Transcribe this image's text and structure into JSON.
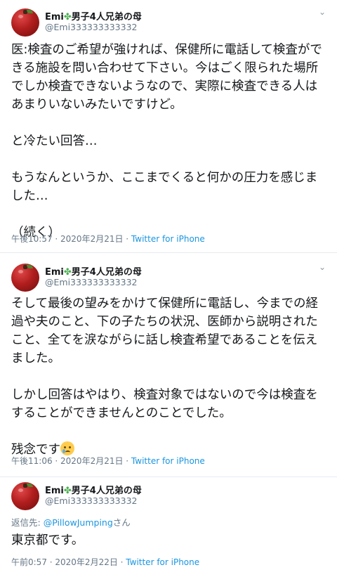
{
  "tweets": [
    {
      "author_name": "Emi",
      "clover": "✤",
      "author_suffix": "男子4人兄弟の母",
      "handle": "@Emi333333333332",
      "text": "医:検査のご希望が強ければ、保健所に電話して検査ができる施設を問い合わせて下さい。今はごく限られた場所でしか検査できないようなので、実際に検査できる人はあまりいないみたいですけど。\n\nと冷たい回答…\n\nもうなんというか、ここまでくると何かの圧力を感じました…\n\n（続く）",
      "timestamp": "午後10:57 · 2020年2月21日 · ",
      "source": "Twitter for iPhone"
    },
    {
      "author_name": "Emi",
      "clover": "✤",
      "author_suffix": "男子4人兄弟の母",
      "handle": "@Emi333333333332",
      "text": "そして最後の望みをかけて保健所に電話し、今までの経過や夫のこと、下の子たちの状況、医師から説明されたこと、全てを涙ながらに話し検査希望であることを伝えました。\n\nしかし回答はやはり、検査対象ではないので今は検査をすることができませんとのことでした。\n\n残念です",
      "timestamp": "午後11:06 · 2020年2月21日 · ",
      "source": "Twitter for iPhone",
      "emoji": "crying-face"
    },
    {
      "author_name": "Emi",
      "clover": "✤",
      "author_suffix": "男子4人兄弟の母",
      "handle": "@Emi333333333332",
      "reply_prefix": "返信先: ",
      "reply_mention": "@PillowJumping",
      "reply_suffix": "さん",
      "text": "東京都です。",
      "timestamp": "午前0:57 · 2020年2月22日 · ",
      "source": "Twitter for iPhone"
    }
  ],
  "chevron": "⌄"
}
